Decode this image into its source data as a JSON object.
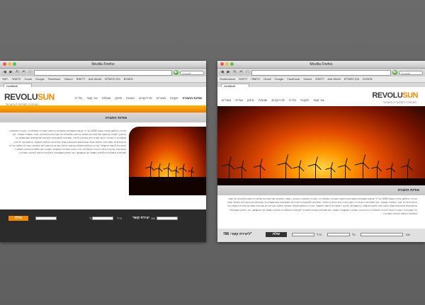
{
  "browser": {
    "title": "Mozilla Firefox",
    "search_placeholder": "Google",
    "tab_label": "(Untitled)",
    "bookmarks_left": [
      "ראשי",
      "הרשמה",
      "Gmail",
      "Google",
      "Facebook",
      "Yahoo!",
      "דרושים",
      "Ads World",
      "בנק הפועלים",
      "מיוצאים"
    ],
    "bookmarks_right": [
      "Shutterstock",
      "דרושים",
      "הרשמה",
      "Gmail",
      "Google",
      "Facebook",
      "Yahoo!",
      "דרושים",
      "Ads World",
      "בנק הפועלים",
      "מיוצאים"
    ]
  },
  "site": {
    "logo_revolu": "REVOLU",
    "logo_sun": "SUN",
    "tagline": "המהפכה הסולארית בישראל",
    "nav": [
      "אודות החברה",
      "תקנות",
      "מוצרים",
      "פרוייקטים",
      "הצעות",
      "מימון",
      "שאלות",
      "צור קשר",
      "גלריה"
    ],
    "nav_right": [
      "צור קשר",
      "תקנות",
      "גלריה",
      "פרוייקטים",
      "שאלות",
      "מימון",
      "אודות",
      "מוצרים"
    ],
    "section_title": "אודות החברה",
    "body": "חברת רבולושן נוסדה בשנת 2008 על ידי קבוצת משקיעים ומומחים בתחום האנרגיה הסולארית. החברה מתמחה בתכנון, הקמה ותחזוקה של מערכות סולאריות פוטו-וולטאיות על גגות בתים פרטיים, מבני תעשייה ומסחר. אנו מאמינים כי אנרגיה ירוקה ונקייה היא הפתרון לעתיד, ומציעים ללקוחותינו פתרונות מתקדמים המבוססים על הטכנולוגיות המובילות בעולם. צוות המהנדסים והטכנאים שלנו מלווה את הלקוח מהשלב הראשון ועד לחיבור המערכת לרשת החשמל. חברת רבולושן פועלת בשיתוף פעולה עם יצרנים מובילים ומעניקה אחריות מלאה על כל המערכות. החברה זכתה להכרה ולהצלחה רבה בזכות השירות המקצועי והאמין. אנו מזמינים אתכם להצטרף למהפכה הסולארית ולהפיק חשמל נקי מהשמש, תוך חיסכון משמעותי בעלויות ותרומה לאיכות הסביבה.",
    "contact_label": "יצירת קשר",
    "phone_label": "ליצירת קשר: 786*",
    "name_label": "שם",
    "tel_label": "טל",
    "mail_label": "מייל",
    "send_label": "שלח"
  }
}
